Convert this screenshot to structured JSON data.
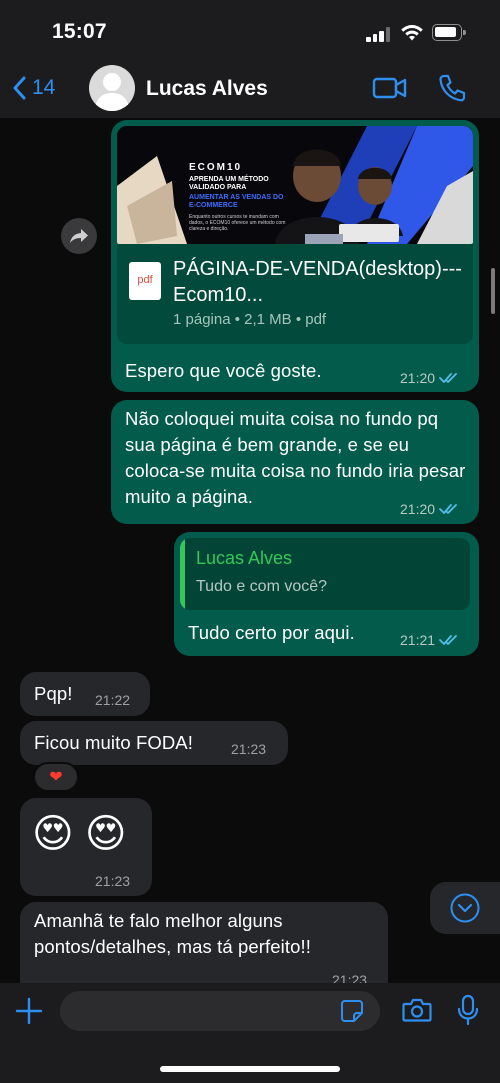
{
  "status_bar": {
    "time": "15:07"
  },
  "header": {
    "back_count": "14",
    "contact_name": "Lucas Alves"
  },
  "colors": {
    "accent": "#2f8ff0",
    "outgoing_bubble": "#035c4b",
    "incoming_bubble": "#26272a",
    "quote_green": "#34c759",
    "read_ticks": "#53bdeb"
  },
  "messages": {
    "document": {
      "thumb_brand": "ECOM10",
      "thumb_headline": "APRENDA UM MÉTODO VALIDADO PARA",
      "thumb_highlight": "AUMENTAR AS VENDAS DO E-COMMERCE",
      "thumb_body": "Enquanto outros cursos te inundam com dados, o ECOM10 oferece um método com clareza e direção.",
      "icon_label": "pdf",
      "file_name": "PÁGINA-DE-VENDA(desktop)---Ecom10...",
      "file_meta": "1 página • 2,1 MB • pdf",
      "caption": "Espero que você goste.",
      "time": "21:20"
    },
    "out_2": {
      "text": "Não coloquei muita coisa no fundo pq sua página é bem grande, e se eu coloca-se muita coisa no fundo iria pesar muito a página.",
      "time": "21:20"
    },
    "out_3": {
      "quote_author": "Lucas Alves",
      "quote_text": "Tudo e com você?",
      "text": "Tudo certo por aqui.",
      "time": "21:21"
    },
    "in_1": {
      "text": "Pqp!",
      "time": "21:22"
    },
    "in_2": {
      "text": "Ficou muito FODA!",
      "time": "21:23",
      "reaction": "❤"
    },
    "in_3": {
      "emoji": "😍 😍",
      "time": "21:23"
    },
    "in_4": {
      "text": "Amanhã te falo melhor alguns pontos/detalhes, mas tá perfeito!!",
      "time": "21:23"
    }
  },
  "input": {
    "placeholder": ""
  }
}
